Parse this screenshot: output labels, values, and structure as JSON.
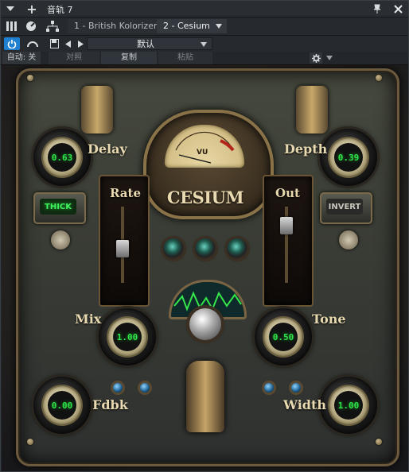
{
  "window": {
    "title": "音轨 7"
  },
  "tabs": [
    {
      "label": "1 - British Kolorizer"
    },
    {
      "label": "2 - Cesium"
    }
  ],
  "preset": {
    "name": "默认"
  },
  "subtoolbar": {
    "auto_label": "自动: 关",
    "compare_label": "对照",
    "copy_label": "复制",
    "paste_label": "粘贴"
  },
  "plugin": {
    "brand": "CESIUM",
    "vu_label": "VU",
    "knobs": {
      "delay": {
        "label": "Delay",
        "value": "0.63"
      },
      "depth": {
        "label": "Depth",
        "value": "0.39"
      },
      "mix": {
        "label": "Mix",
        "value": "1.00"
      },
      "tone": {
        "label": "Tone",
        "value": "0.50"
      },
      "fdbk": {
        "label": "Fdbk",
        "value": "0.00"
      },
      "width": {
        "label": "Width",
        "value": "1.00"
      }
    },
    "sliders": {
      "rate": {
        "label": "Rate",
        "level": 0.45
      },
      "out": {
        "label": "Out",
        "level": 0.75
      }
    },
    "buttons": {
      "thick": {
        "label": "THICK",
        "active": true
      },
      "invert": {
        "label": "INVERT",
        "active": false
      }
    }
  },
  "colors": {
    "value_green": "#2fe24a",
    "brand_cream": "#e8d9b0",
    "accent_blue": "#1f7fd0"
  }
}
